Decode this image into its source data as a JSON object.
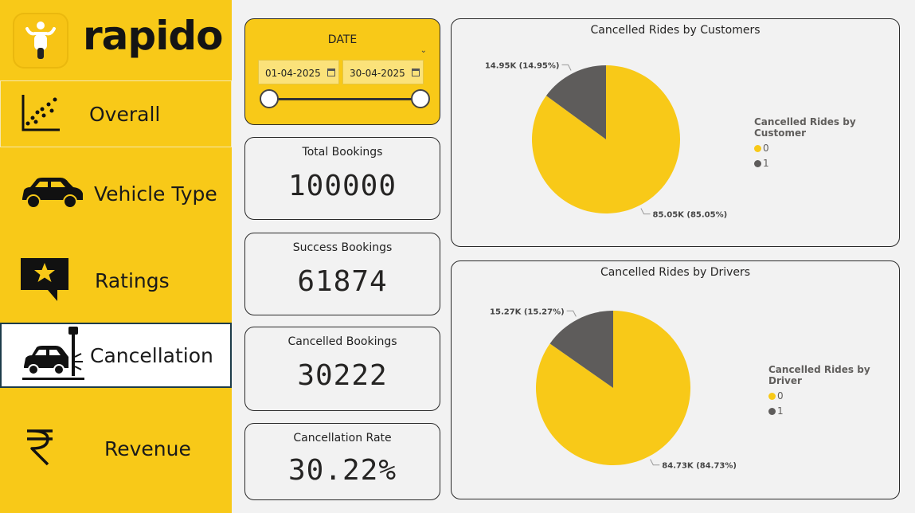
{
  "brand": {
    "name": "rapido",
    "accent": "#f8c918"
  },
  "nav": [
    {
      "label": "Overall",
      "icon": "scatter-plot-icon"
    },
    {
      "label": "Vehicle Type",
      "icon": "car-icon"
    },
    {
      "label": "Ratings",
      "icon": "star-speech-bubble-icon"
    },
    {
      "label": "Cancellation",
      "icon": "car-crash-icon"
    },
    {
      "label": "Revenue",
      "icon": "rupee-icon"
    }
  ],
  "date_filter": {
    "title": "DATE",
    "start": "01-04-2025",
    "end": "30-04-2025"
  },
  "kpis": {
    "total": {
      "title": "Total Bookings",
      "value": "100000"
    },
    "success": {
      "title": "Success Bookings",
      "value": "61874"
    },
    "cancelled": {
      "title": "Cancelled Bookings",
      "value": "30222"
    },
    "rate": {
      "title": "Cancellation Rate",
      "value": "30.22%"
    }
  },
  "chart_data": [
    {
      "type": "pie",
      "title": "Cancelled Rides by Customers",
      "legend_title": "Cancelled Rides by Customer",
      "legend_position": "right",
      "categories": [
        "0",
        "1"
      ],
      "values": [
        85050,
        14950
      ],
      "labels": [
        "85.05K (85.05%)",
        "14.95K (14.95%)"
      ],
      "colors": [
        "#f8c918",
        "#5e5c5b"
      ]
    },
    {
      "type": "pie",
      "title": "Cancelled Rides by Drivers",
      "legend_title": "Cancelled Rides by Driver",
      "legend_position": "right",
      "categories": [
        "0",
        "1"
      ],
      "values": [
        84730,
        15270
      ],
      "labels": [
        "84.73K (84.73%)",
        "15.27K (15.27%)"
      ],
      "colors": [
        "#f8c918",
        "#5e5c5b"
      ]
    }
  ]
}
